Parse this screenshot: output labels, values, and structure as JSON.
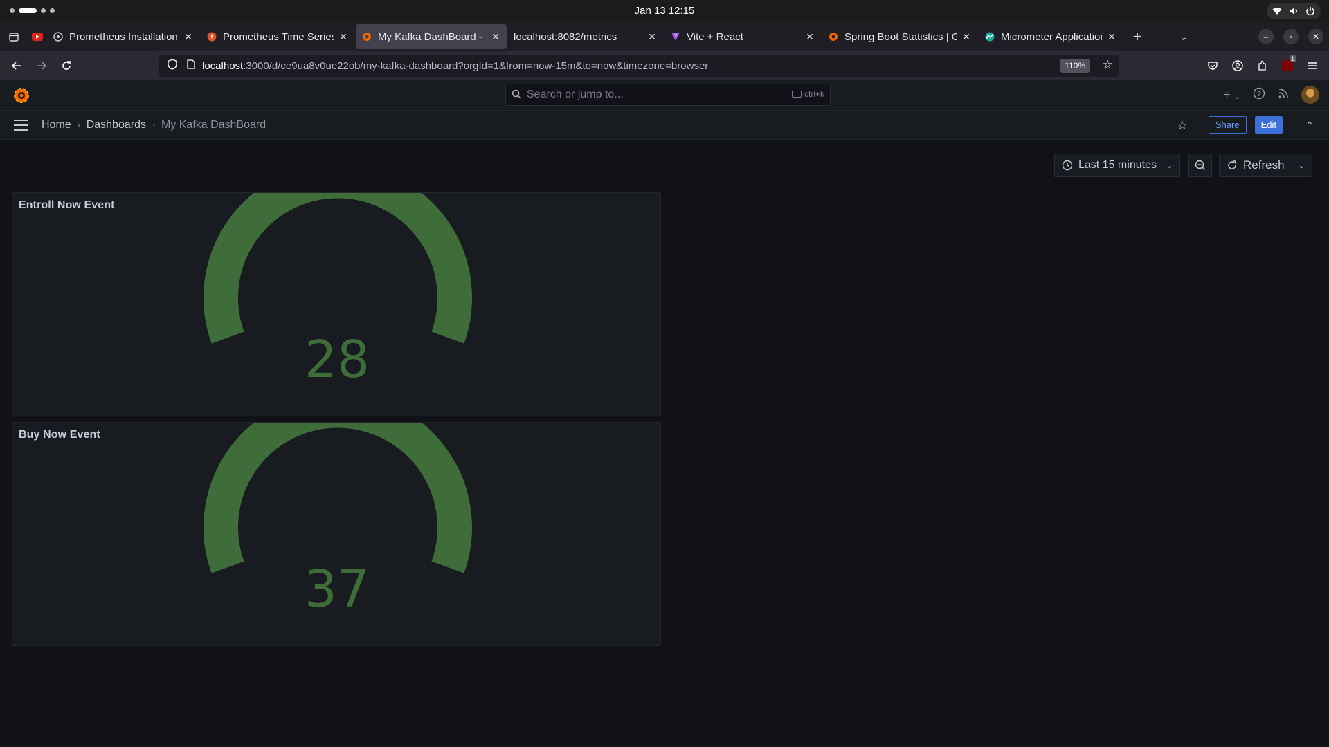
{
  "os": {
    "clock": "Jan 13  12:15"
  },
  "browser": {
    "tabs": [
      {
        "title": "Prometheus Installation S",
        "icon": "prometheus-icon",
        "active": false
      },
      {
        "title": "Prometheus Time Series C",
        "icon": "prometheus-fire-icon",
        "active": false
      },
      {
        "title": "My Kafka DashBoard - Da",
        "icon": "grafana-icon",
        "active": true
      },
      {
        "title": "localhost:8082/metrics",
        "icon": "",
        "active": false
      },
      {
        "title": "Vite + React",
        "icon": "vite-icon",
        "active": false
      },
      {
        "title": "Spring Boot Statistics | Gr",
        "icon": "grafana-icon",
        "active": false
      },
      {
        "title": "Micrometer Application C",
        "icon": "micrometer-icon",
        "active": false
      }
    ],
    "url_host": "localhost",
    "url_rest": ":3000/d/ce9ua8v0ue22ob/my-kafka-dashboard?orgId=1&from=now-15m&to=now&timezone=browser",
    "zoom": "110%",
    "ublock_count": "1"
  },
  "grafana": {
    "search_placeholder": "Search or jump to...",
    "search_shortcut": "ctrl+k",
    "breadcrumbs": [
      "Home",
      "Dashboards",
      "My Kafka DashBoard"
    ],
    "share_label": "Share",
    "edit_label": "Edit",
    "time_range": "Last 15 minutes",
    "refresh_label": "Refresh",
    "gauge_color": "#3e6d3a"
  },
  "panels": [
    {
      "title": "Entroll Now Event",
      "value": "28"
    },
    {
      "title": "Buy Now Event",
      "value": "37"
    }
  ]
}
